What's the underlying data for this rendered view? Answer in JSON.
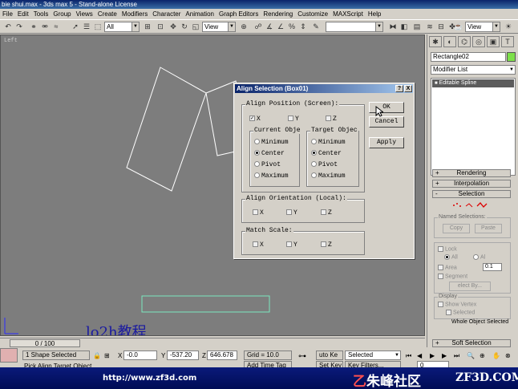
{
  "window": {
    "title": "bie shui.max - 3ds max 5 - Stand-alone License"
  },
  "menu": [
    "File",
    "Edit",
    "Tools",
    "Group",
    "Views",
    "Create",
    "Modifiers",
    "Character",
    "Animation",
    "Graph Editors",
    "Rendering",
    "Customize",
    "MAXScript",
    "Help"
  ],
  "toolbar": {
    "selection_filter": "All",
    "ref_coord": "View",
    "named_sel": "",
    "view_right": "View"
  },
  "viewport": {
    "label": "Left",
    "watermark": "lo2h教程"
  },
  "dialog": {
    "title": "Align Selection (Box01)",
    "help_btn": "?",
    "close_btn": "X",
    "align_position": {
      "label": "Align Position (Screen):",
      "x": "X",
      "y": "Y",
      "z": "Z",
      "x_checked": true,
      "y_checked": false,
      "z_checked": false
    },
    "current_object": {
      "label": "Current Obje",
      "options": [
        "Minimum",
        "Center",
        "Pivot",
        "Maximum"
      ],
      "selected": "Center"
    },
    "target_object": {
      "label": "Target Objec",
      "options": [
        "Minimum",
        "Center",
        "Pivot",
        "Maximum"
      ],
      "selected": "Center"
    },
    "align_orientation": {
      "label": "Align Orientation (Local):",
      "x": "X",
      "y": "Y",
      "z": "Z"
    },
    "match_scale": {
      "label": "Match Scale:",
      "x": "X",
      "y": "Y",
      "z": "Z"
    },
    "ok": "OK",
    "cancel": "Cancel",
    "apply": "Apply"
  },
  "cmdpanel": {
    "object_name": "Rectangle02",
    "object_color": "#7de04a",
    "modifier_list": "Modifier List",
    "stack_item": "Editable Spline",
    "rollouts": {
      "rendering": "Rendering",
      "interpolation": "Interpolation",
      "selection": "Selection",
      "soft_selection": "Soft Selection"
    },
    "named_selections": "Named Selections:",
    "copy": "Copy",
    "paste": "Paste",
    "lock": "Lock",
    "all": "All",
    "al": "Al",
    "area": "Area",
    "area_value": "0.1",
    "segment": "Segment",
    "select_by": "elect By...",
    "display": "Display",
    "show_vertex": "Show Vertex",
    "selected": "Selected",
    "whole_object_selected": "Whole Object Selected"
  },
  "timebar": {
    "frame": "0 / 100"
  },
  "status": {
    "selection": "1 Shape Selected",
    "x_label": "X",
    "x": "-0.0",
    "y_label": "Y",
    "y": "-537.20",
    "z_label": "Z",
    "z": "646.678",
    "grid": "Grid = 10.0",
    "auto_key": "uto Ke",
    "selected_dd": "Selected",
    "set_key": "Set Key",
    "key_filters": "Key Filters...",
    "frame_field": "0",
    "prompt": "Pick Align Target Object",
    "add_time_tag": "Add Time Tag"
  },
  "banner": {
    "url": "http://www.zf3d.com",
    "cn": "朱峰社区",
    "brand": "ZF3D.COM"
  }
}
